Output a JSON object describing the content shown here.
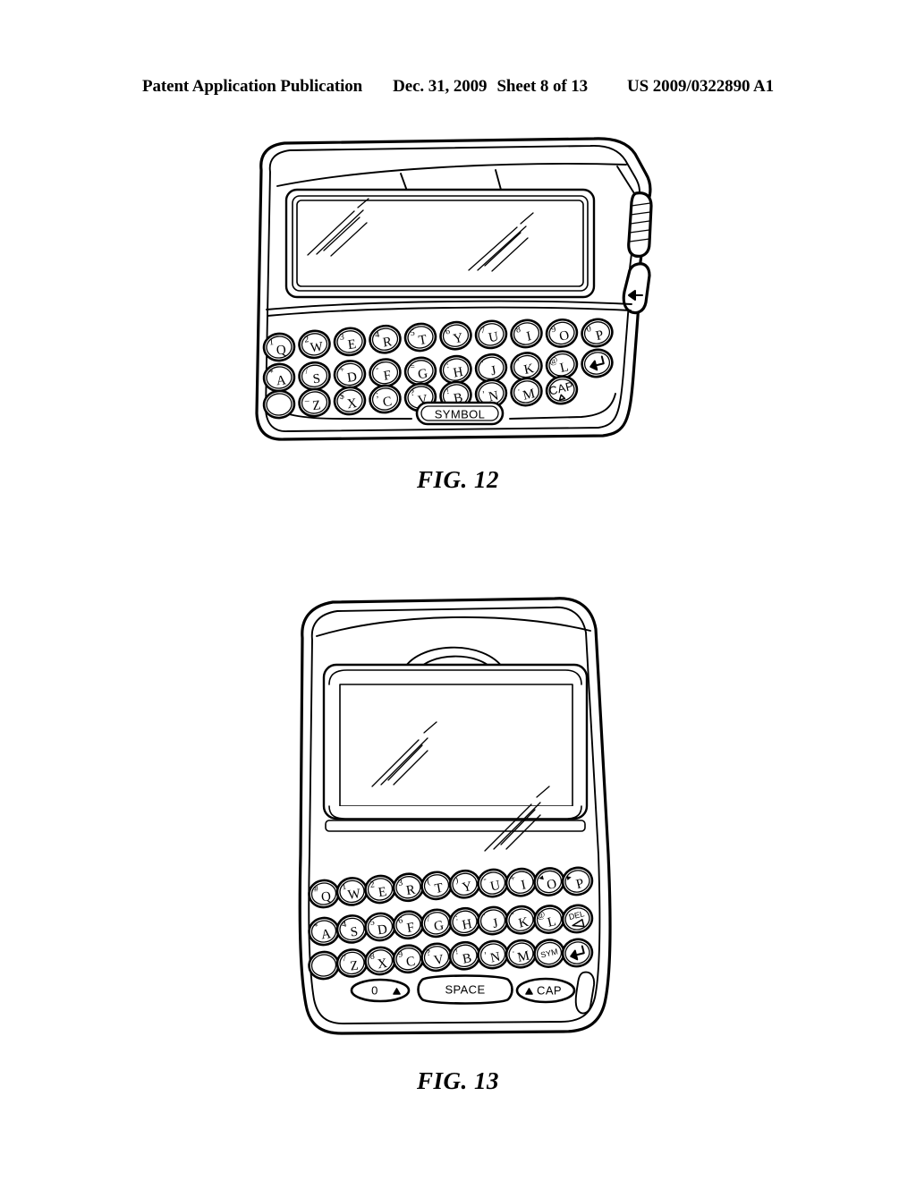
{
  "header": {
    "publication": "Patent Application Publication",
    "date": "Dec. 31, 2009",
    "sheet": "Sheet 8 of 13",
    "patent_number": "US 2009/0322890 A1"
  },
  "figures": [
    {
      "caption": "FIG. 12",
      "device_orientation": "landscape",
      "display": {
        "shape": "rectangle",
        "content": "blank",
        "glare_marks": 2
      },
      "side_controls": [
        {
          "name": "scroll-wheel",
          "label": ""
        },
        {
          "name": "back-button",
          "label": "⇦"
        }
      ],
      "keyboard": {
        "rows": [
          [
            {
              "letter": "Q",
              "sup": "1"
            },
            {
              "letter": "W",
              "sup": "2"
            },
            {
              "letter": "E",
              "sup": "3"
            },
            {
              "letter": "R",
              "sup": "4"
            },
            {
              "letter": "T",
              "sup": "5"
            },
            {
              "letter": "Y",
              "sup": "6"
            },
            {
              "letter": "U",
              "sup": "7"
            },
            {
              "letter": "I",
              "sup": "8"
            },
            {
              "letter": "O",
              "sup": "9"
            },
            {
              "letter": "P",
              "sup": "0"
            }
          ],
          [
            {
              "letter": "A",
              "sup": "*"
            },
            {
              "letter": "S",
              "sup": "/"
            },
            {
              "letter": "D",
              "sup": "+"
            },
            {
              "letter": "F",
              "sup": "-"
            },
            {
              "letter": "G",
              "sup": "="
            },
            {
              "letter": "H",
              "sup": ":"
            },
            {
              "letter": "J",
              "sup": "'"
            },
            {
              "letter": "K",
              "sup": "\""
            },
            {
              "letter": "L",
              "sup": "@"
            },
            {
              "letter": "",
              "sup": "",
              "special": "enter"
            }
          ],
          [
            {
              "letter": "",
              "sup": "",
              "special": "blank"
            },
            {
              "letter": "Z",
              "sup": "_"
            },
            {
              "letter": "X",
              "sup": "$"
            },
            {
              "letter": "C",
              "sup": ";"
            },
            {
              "letter": "V",
              "sup": "?"
            },
            {
              "letter": "B",
              "sup": "!"
            },
            {
              "letter": "N",
              "sup": ","
            },
            {
              "letter": "M",
              "sup": "."
            },
            {
              "letter": "CAP",
              "sup": "",
              "special": "cap"
            }
          ]
        ],
        "bottom_keys": [
          {
            "label": "SYMBOL"
          }
        ]
      }
    },
    {
      "caption": "FIG. 13",
      "device_orientation": "portrait",
      "display": {
        "shape": "rectangle",
        "content": "blank",
        "glare_marks": 2
      },
      "side_controls": [
        {
          "name": "speaker-grille",
          "label": ""
        }
      ],
      "keyboard": {
        "rows": [
          [
            {
              "letter": "Q",
              "sup": "#"
            },
            {
              "letter": "W",
              "sup": "1"
            },
            {
              "letter": "E",
              "sup": "2"
            },
            {
              "letter": "R",
              "sup": "3"
            },
            {
              "letter": "T",
              "sup": "("
            },
            {
              "letter": "Y",
              "sup": ")"
            },
            {
              "letter": "U",
              "sup": "-"
            },
            {
              "letter": "I",
              "sup": "+"
            },
            {
              "letter": "O",
              "sup": "◂"
            },
            {
              "letter": "P",
              "sup": "▸"
            }
          ],
          [
            {
              "letter": "A",
              "sup": "*"
            },
            {
              "letter": "S",
              "sup": "4"
            },
            {
              "letter": "D",
              "sup": "5"
            },
            {
              "letter": "F",
              "sup": "6"
            },
            {
              "letter": "G",
              "sup": "/"
            },
            {
              "letter": "H",
              "sup": ":"
            },
            {
              "letter": "J",
              "sup": "'"
            },
            {
              "letter": "K",
              "sup": "\""
            },
            {
              "letter": "L",
              "sup": "@"
            },
            {
              "letter": "DEL",
              "sup": "",
              "special": "del"
            }
          ],
          [
            {
              "letter": "",
              "sup": "",
              "special": "blank"
            },
            {
              "letter": "Z",
              "sup": "7"
            },
            {
              "letter": "X",
              "sup": "8"
            },
            {
              "letter": "C",
              "sup": "9"
            },
            {
              "letter": "V",
              "sup": "?"
            },
            {
              "letter": "B",
              "sup": "!"
            },
            {
              "letter": "N",
              "sup": ","
            },
            {
              "letter": "M",
              "sup": "."
            },
            {
              "letter": "SYM",
              "sup": "",
              "special": "sym"
            },
            {
              "letter": "",
              "sup": "",
              "special": "enter"
            }
          ]
        ],
        "bottom_keys": [
          {
            "label": "0"
          },
          {
            "label": "SPACE"
          },
          {
            "label": "CAP"
          }
        ]
      }
    }
  ]
}
